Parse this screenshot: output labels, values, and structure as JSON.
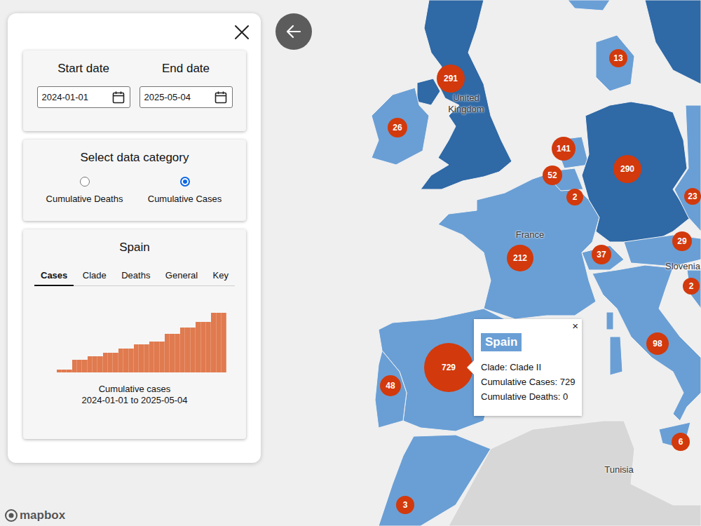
{
  "sidebar": {
    "date_range": {
      "start": {
        "label": "Start date",
        "value": "2024-01-01"
      },
      "end": {
        "label": "End date",
        "value": "2025-05-04"
      }
    },
    "category": {
      "title": "Select data category",
      "options": [
        {
          "label": "Cumulative Deaths",
          "selected": false
        },
        {
          "label": "Cumulative Cases",
          "selected": true
        }
      ]
    },
    "country_panel": {
      "title": "Spain",
      "tabs": [
        {
          "label": "Cases",
          "selected": true
        },
        {
          "label": "Clade",
          "selected": false
        },
        {
          "label": "Deaths",
          "selected": false
        },
        {
          "label": "General",
          "selected": false
        },
        {
          "label": "Key",
          "selected": false
        }
      ],
      "chart": {
        "values": [
          35,
          35,
          35,
          154,
          154,
          154,
          197,
          197,
          197,
          240,
          240,
          240,
          292,
          292,
          292,
          343,
          343,
          343,
          377,
          377,
          377,
          472,
          472,
          472,
          549,
          549,
          549,
          617,
          617,
          617,
          729,
          729,
          729
        ],
        "caption": [
          "Cumulative cases",
          "2024-01-01 to 2025-05-04"
        ]
      }
    }
  },
  "map": {
    "regions": [
      {
        "color": "#2f69a6"
      },
      {
        "color": "#2f69a6"
      },
      {
        "color": "#6a9fd5"
      },
      {
        "color": "#6a9fd5"
      },
      {
        "color": "#6a9fd5"
      },
      {
        "color": "#6a9fd5"
      },
      {
        "color": "#6a9fd5"
      },
      {
        "color": "#d7d7d7"
      },
      {
        "color": "#6a9fd5"
      },
      {
        "color": "#6a9fd5"
      },
      {
        "color": "#2f69a6"
      },
      {
        "color": "#6a9fd5"
      },
      {
        "color": "#2f69a6"
      },
      {
        "color": "#6a9fd5"
      },
      {
        "color": "#6a9fd5"
      },
      {
        "color": "#6a9fd5"
      },
      {
        "color": "#6a9fd5"
      },
      {
        "color": "#6a9fd5"
      },
      {
        "color": "#6a9fd5"
      },
      {
        "color": "#6a9fd5"
      },
      {
        "color": "#6a9fd5"
      },
      {
        "color": "#6a9fd5"
      }
    ],
    "labels": [
      {
        "text": "United Kingdom"
      },
      {
        "text": "France"
      },
      {
        "text": "Slovenia"
      },
      {
        "text": "Tunisia"
      }
    ],
    "markers": [
      {
        "count": "291"
      },
      {
        "count": "13"
      },
      {
        "count": "26"
      },
      {
        "count": "141"
      },
      {
        "count": "52"
      },
      {
        "count": "2"
      },
      {
        "count": "290"
      },
      {
        "count": "23"
      },
      {
        "count": "212"
      },
      {
        "count": "37"
      },
      {
        "count": "29"
      },
      {
        "count": "2"
      },
      {
        "count": "98"
      },
      {
        "count": "729"
      },
      {
        "count": "48"
      },
      {
        "count": "6"
      },
      {
        "count": "3"
      }
    ],
    "popup": {
      "title": "Spain",
      "close": "×",
      "lines": [
        "Clade: Clade II",
        "Cumulative Cases: 729",
        "Cumulative Deaths: 0"
      ]
    },
    "attribution": {
      "text": "mapbox"
    }
  }
}
